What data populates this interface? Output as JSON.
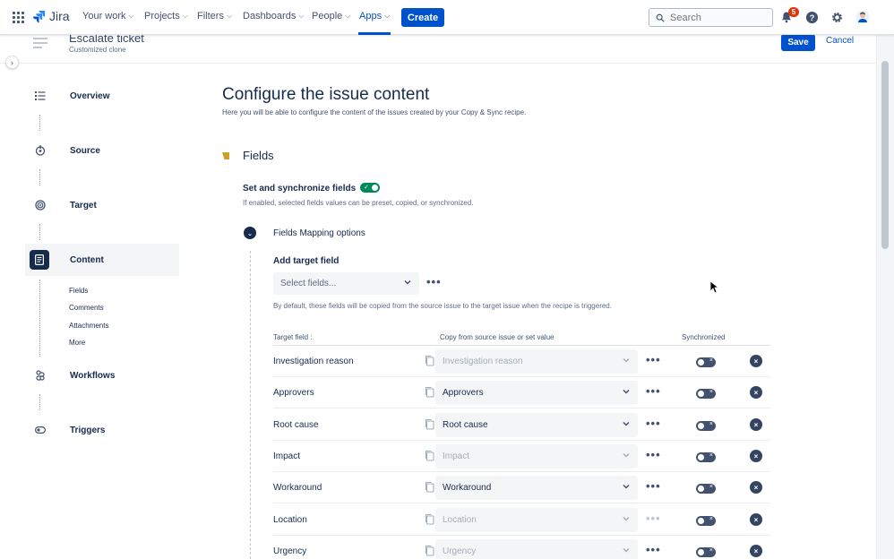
{
  "nav": {
    "logo_text": "Jira",
    "items": [
      {
        "label": "Your work"
      },
      {
        "label": "Projects"
      },
      {
        "label": "Filters"
      },
      {
        "label": "Dashboards"
      },
      {
        "label": "People"
      },
      {
        "label": "Apps"
      }
    ],
    "active_item": "Apps",
    "create_label": "Create",
    "search_placeholder": "Search",
    "notifications_count": "5",
    "icons": [
      "app-switcher-icon",
      "notification-icon",
      "help-icon",
      "settings-icon",
      "profile-avatar"
    ]
  },
  "header": {
    "title": "Escalate ticket",
    "subtitle": "Customized clone",
    "save_label": "Save",
    "cancel_label": "Cancel"
  },
  "sidebar": {
    "steps": [
      {
        "label": "Overview",
        "icon": "list-icon"
      },
      {
        "label": "Source",
        "icon": "source-icon"
      },
      {
        "label": "Target",
        "icon": "target-icon"
      },
      {
        "label": "Content",
        "icon": "document-icon"
      },
      {
        "label": "Workflows",
        "icon": "workflow-icon"
      },
      {
        "label": "Triggers",
        "icon": "trigger-icon"
      }
    ],
    "active_step": "Content",
    "content_subitems": [
      "Fields",
      "Comments",
      "Attachments",
      "More"
    ]
  },
  "main": {
    "title": "Configure the issue content",
    "description": "Here you will be able to configure the content of the issues created by your Copy & Sync recipe.",
    "section_title": "Fields",
    "sync_label": "Set and synchronize fields",
    "sync_enabled": true,
    "sync_description": "If enabled, selected fields values can be preset, copied, or synchronized.",
    "mapping_label": "Fields Mapping options",
    "add_target_label": "Add target field",
    "select_placeholder": "Select fields...",
    "add_description": "By default, these fields will be copied from the source issue to the target issue when the recipe is triggered.",
    "columns": {
      "target": "Target field :",
      "copy": "Copy from source issue or set value",
      "synchronized": "Synchronized"
    },
    "rows": [
      {
        "target": "Investigation reason",
        "value": "Investigation reason",
        "dim": true,
        "synchronized": false,
        "more_dim": false
      },
      {
        "target": "Approvers",
        "value": "Approvers",
        "dim": false,
        "synchronized": false,
        "more_dim": false
      },
      {
        "target": "Root cause",
        "value": "Root cause",
        "dim": false,
        "synchronized": false,
        "more_dim": false
      },
      {
        "target": "Impact",
        "value": "Impact",
        "dim": true,
        "synchronized": false,
        "more_dim": false
      },
      {
        "target": "Workaround",
        "value": "Workaround",
        "dim": false,
        "synchronized": false,
        "more_dim": false
      },
      {
        "target": "Location",
        "value": "Location",
        "dim": true,
        "synchronized": false,
        "more_dim": true
      },
      {
        "target": "Urgency",
        "value": "Urgency",
        "dim": true,
        "synchronized": false,
        "more_dim": false
      }
    ]
  },
  "colors": {
    "primary": "#0052cc",
    "text": "#172b4d",
    "toggle_on": "#00875a",
    "toggle_off": "#42526e",
    "badge": "#de350b"
  }
}
